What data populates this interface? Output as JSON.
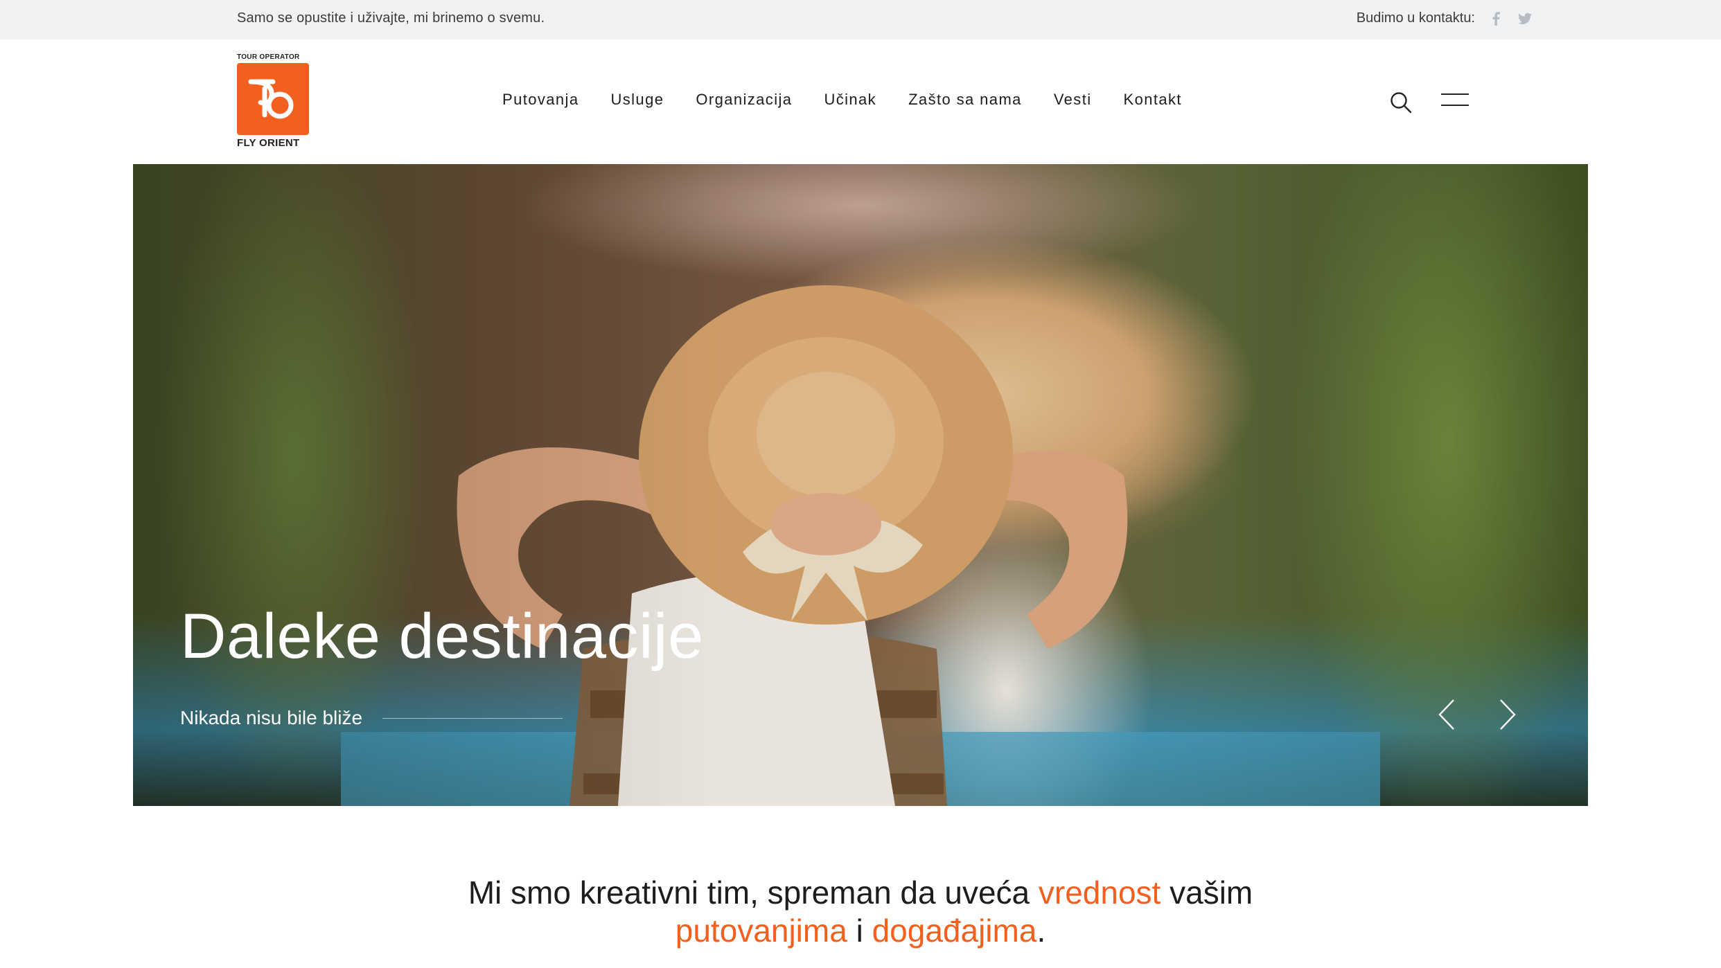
{
  "topbar": {
    "tagline": "Samo se opustite i uživajte, mi brinemo o svemu.",
    "contact_label": "Budimo u kontaktu:",
    "social": [
      {
        "icon": "facebook-icon"
      },
      {
        "icon": "twitter-icon"
      }
    ]
  },
  "logo": {
    "over_text": "TOUR OPERATOR",
    "name": "FLY ORIENT",
    "brand_color": "#f2601f"
  },
  "nav": {
    "items": [
      {
        "label": "Putovanja"
      },
      {
        "label": "Usluge"
      },
      {
        "label": "Organizacija"
      },
      {
        "label": "Učinak"
      },
      {
        "label": "Zašto sa nama"
      },
      {
        "label": "Vesti"
      },
      {
        "label": "Kontakt"
      }
    ]
  },
  "header_icons": {
    "search": "search-icon",
    "menu": "menu-icon"
  },
  "hero": {
    "title": "Daleke destinacije",
    "subtitle": "Nikada nisu bile bliže",
    "prev_icon": "chevron-left-icon",
    "next_icon": "chevron-right-icon"
  },
  "intro": {
    "part1": "Mi smo kreativni tim, spreman da uveća ",
    "highlight1": "vrednost",
    "part2": " vašim",
    "highlight2": "putovanjima",
    "part3": " i ",
    "highlight3": "događajima",
    "part4": ".",
    "accent_color": "#f2601f"
  }
}
